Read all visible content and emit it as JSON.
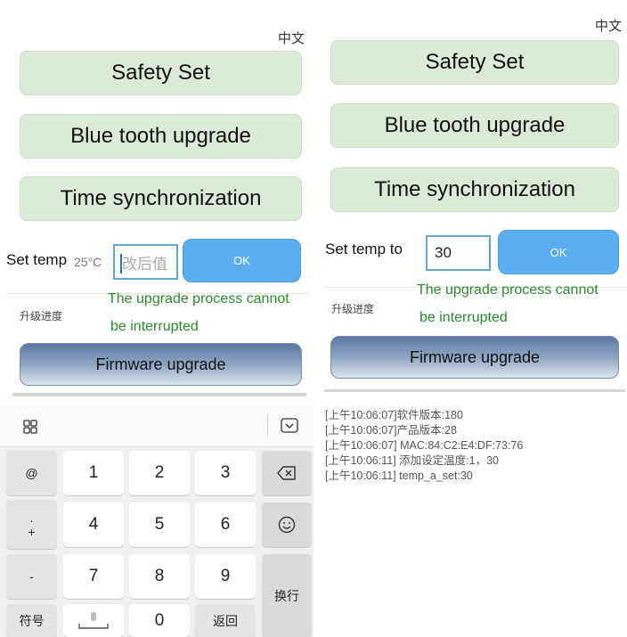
{
  "left": {
    "lang_label": "中文",
    "menu": [
      "Safety Set",
      "Blue tooth upgrade",
      "Time synchronization"
    ],
    "set_temp_label": "Set temp",
    "current_temp": "25°C",
    "temp_input_placeholder": "改后值",
    "ok_label": "OK",
    "progress_label": "升级进度",
    "upgrade_note": [
      "The upgrade process cannot",
      "be interrupted"
    ],
    "firmware_label": "Firmware upgrade"
  },
  "keyboard": {
    "grid_icon": "grid-icon",
    "hide_icon": "keyboard-hide-icon",
    "side_keys": [
      "@",
      ". ",
      "+",
      "-",
      "符号"
    ],
    "digits": [
      "1",
      "2",
      "3",
      "4",
      "5",
      "6",
      "7",
      "8",
      "9",
      "0"
    ],
    "backspace_icon": "backspace-icon",
    "emoji_icon": "emoji-icon",
    "enter_label": "换行",
    "space_icon": "mic-space-icon",
    "return_label": "返回"
  },
  "right": {
    "lang_label": "中文",
    "menu": [
      "Safety Set",
      "Blue tooth upgrade",
      "Time synchronization"
    ],
    "set_temp_label": "Set temp to",
    "temp_input_value": "30",
    "ok_label": "OK",
    "progress_label": "升级进度",
    "upgrade_note": [
      "The upgrade process cannot",
      "be interrupted"
    ],
    "firmware_label": "Firmware upgrade",
    "log_lines": [
      "[上午10:06:07]软件版本:180",
      "[上午10:06:07]产品版本:28",
      "[上午10:06:07] MAC:84:C2:E4:DF:73:76",
      "[上午10:06:11] 添加设定温度:1，30",
      "[上午10:06:11] temp_a_set:30"
    ]
  },
  "colors": {
    "menu_button_bg": "#dcebd8",
    "ok_button_bg": "#5aaef0",
    "note_text": "#2a8a2a",
    "input_border": "#62a6cc"
  }
}
